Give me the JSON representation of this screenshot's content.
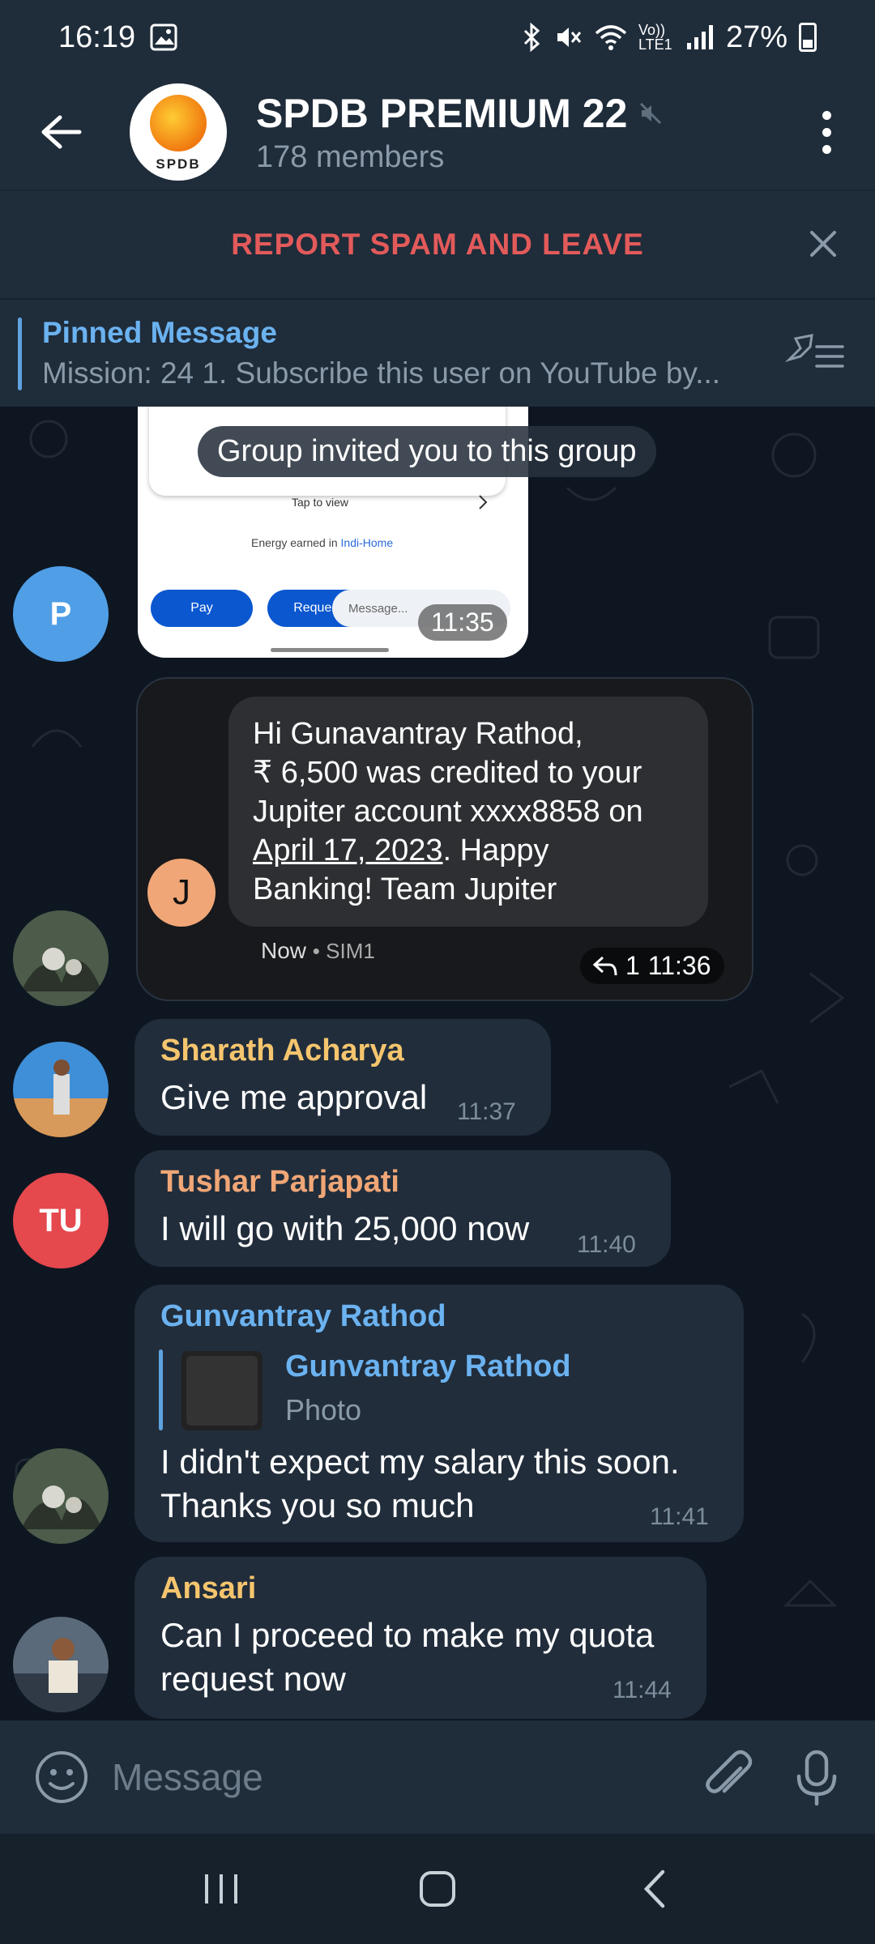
{
  "status_bar": {
    "time": "16:19",
    "battery": "27%",
    "network": "Vo)) LTE1"
  },
  "header": {
    "title": "SPDB PREMIUM 22",
    "members": "178 members",
    "logo_text": "SPDB"
  },
  "spam_bar": {
    "label": "REPORT SPAM AND LEAVE"
  },
  "pinned": {
    "title": "Pinned Message",
    "text": "Mission: 24  1. Subscribe this user on YouTube by..."
  },
  "messages": {
    "system": "Group invited you to this group",
    "image1": {
      "avatar_initial": "P",
      "tap_to_view": "Tap to view",
      "energy_text": "Energy earned in",
      "energy_brand": "Indi-Home",
      "pay": "Pay",
      "request": "Request",
      "message_placeholder": "Message...",
      "time": "11:35"
    },
    "sms_forward": {
      "avatar_initial": "J",
      "line1": "Hi Gunavantray Rathod,",
      "line2": "₹ 6,500 was credited to your",
      "line3": "Jupiter account xxxx8858 on",
      "date": "April 17, 2023",
      "line4_rest": ". Happy",
      "line5": "Banking! Team Jupiter",
      "meta_now": "Now",
      "meta_sim": "• SIM1",
      "reply_count": "1",
      "time": "11:36"
    },
    "sharath": {
      "sender": "Sharath Acharya",
      "text": "Give me approval",
      "time": "11:37"
    },
    "tushar": {
      "avatar_initial": "TU",
      "sender": "Tushar Parjapati",
      "text": "I will go with 25,000 now",
      "time": "11:40"
    },
    "gunvantray": {
      "sender": "Gunvantray Rathod",
      "reply_name": "Gunvantray Rathod",
      "reply_type": "Photo",
      "line1": "I didn't expect my salary this soon.",
      "line2": "Thanks you so much",
      "time": "11:41"
    },
    "ansari": {
      "sender": "Ansari",
      "line1": "Can I proceed to make my quota",
      "line2": "request now",
      "time": "11:44"
    }
  },
  "input": {
    "placeholder": "Message"
  },
  "colors": {
    "accent_blue": "#6bb2f0",
    "spam_red": "#e35a5a",
    "sender_yellow": "#f5c56e",
    "sender_orange": "#f0a676",
    "tushar_avatar": "#e5484d",
    "p_avatar": "#4f9ee6"
  }
}
